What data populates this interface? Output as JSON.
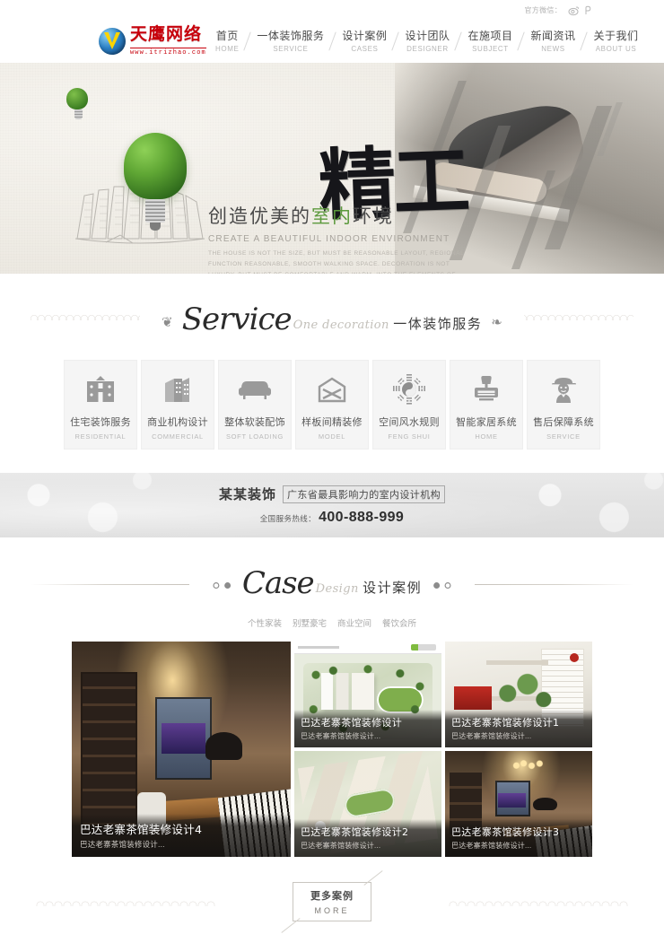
{
  "topbar": {
    "wechat_label": "官方微信：",
    "icons": [
      {
        "name": "weibo-icon"
      },
      {
        "name": "wechat-icon"
      }
    ]
  },
  "logo": {
    "name_cn": "天鹰网络",
    "url": "www.itrizhao.com",
    "icon": "globe-logo-icon"
  },
  "nav": {
    "items": [
      {
        "cn": "首页",
        "en": "HOME"
      },
      {
        "cn": "一体装饰服务",
        "en": "SERVICE"
      },
      {
        "cn": "设计案例",
        "en": "CASES"
      },
      {
        "cn": "设计团队",
        "en": "DESIGNER"
      },
      {
        "cn": "在施项目",
        "en": "SUBJECT"
      },
      {
        "cn": "新闻资讯",
        "en": "NEWS"
      },
      {
        "cn": "关于我们",
        "en": "ABOUT US"
      }
    ]
  },
  "hero": {
    "calligraphy": "精工",
    "headline_pre": "创造优美的",
    "headline_green": "室内",
    "headline_post": "环境",
    "subtitle_en": "CREATE A BEAUTIFUL INDOOR ENVIRONMENT",
    "paragraph": "THE HOUSE IS NOT THE SIZE, BUT MUST BE REASONABLE LAYOUT, REGIONAL FUNCTION REASONABLE, SMOOTH WALKING SPACE. DECORATION IS NOT LUXURY, BUT MUST BE COMFORTABLE AND WARM. INTO THE ELEMENTS OF STYLE, EMBODIES THE HUMANISTIC CONNOTATION."
  },
  "service_section": {
    "script_title": "Service",
    "sub_en": "One decoration",
    "sub_cn": "一体装饰服务",
    "cards": [
      {
        "cn": "住宅装饰服务",
        "en": "RESIDENTIAL",
        "icon": "house-icon"
      },
      {
        "cn": "商业机构设计",
        "en": "COMMERCIAL",
        "icon": "office-buildings-icon"
      },
      {
        "cn": "整体软装配饰",
        "en": "SOFT LOADING",
        "icon": "sofa-icon"
      },
      {
        "cn": "样板间精装修",
        "en": "MODEL",
        "icon": "model-home-icon"
      },
      {
        "cn": "空间风水规则",
        "en": "FENG SHUI",
        "icon": "bagua-icon"
      },
      {
        "cn": "智能家居系统",
        "en": "HOME",
        "icon": "smart-home-icon"
      },
      {
        "cn": "售后保障系统",
        "en": "SERVICE",
        "icon": "worker-icon"
      }
    ]
  },
  "slogan": {
    "brand": "某某装饰",
    "tagline": "广东省最具影响力的室内设计机构",
    "hotline_label": "全国服务热线：",
    "hotline_number": "400-888-999"
  },
  "case_section": {
    "script_title": "Case",
    "sub_en": "Design",
    "sub_cn": "设计案例",
    "filters": [
      "个性家装",
      "别墅豪宅",
      "商业空间",
      "餐饮会所"
    ],
    "items": [
      {
        "title": "巴达老寨茶馆装修设计4",
        "desc": "巴达老寨茶馆装修设计...",
        "layout": "big",
        "photo": "interior"
      },
      {
        "title": "巴达老寨茶馆装修设计",
        "desc": "巴达老寨茶馆装修设计...",
        "layout": "small",
        "photo": "aerial"
      },
      {
        "title": "巴达老寨茶馆装修设计1",
        "desc": "巴达老寨茶馆装修设计...",
        "layout": "small",
        "photo": "office"
      },
      {
        "title": "巴达老寨茶馆装修设计2",
        "desc": "巴达老寨茶馆装修设计...",
        "layout": "small",
        "photo": "aerial2"
      },
      {
        "title": "巴达老寨茶馆装修设计3",
        "desc": "巴达老寨茶馆装修设计...",
        "layout": "small",
        "photo": "interior2"
      }
    ],
    "more_cn": "更多案例",
    "more_en": "MORE"
  },
  "colors": {
    "brand_red": "#c7000b",
    "accent_green": "#5d9a3e",
    "text_dark": "#4a4a4a",
    "text_muted": "#b6b6b6"
  }
}
